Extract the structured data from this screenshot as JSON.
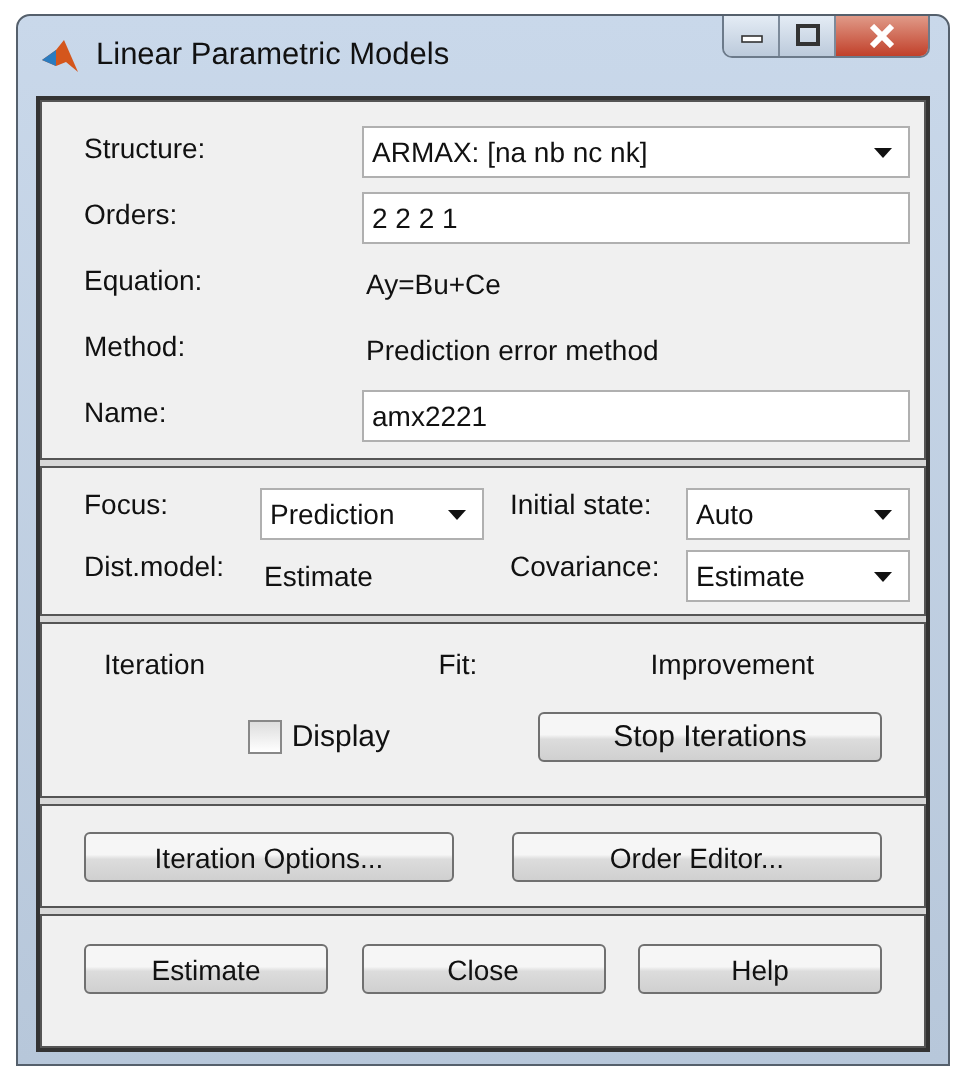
{
  "window": {
    "title": "Linear Parametric Models"
  },
  "model": [
    {
      "kind": "dropdown",
      "label": "Structure:",
      "value": "ARMAX: [na nb nc nk]"
    },
    {
      "kind": "input",
      "label": "Orders:",
      "value": "2 2 2 1"
    },
    {
      "kind": "text",
      "label": "Equation:",
      "value": "Ay=Bu+Ce"
    },
    {
      "kind": "text",
      "label": "Method:",
      "value": "Prediction error method"
    },
    {
      "kind": "input",
      "label": "Name:",
      "value": "amx2221"
    }
  ],
  "options": {
    "focus": {
      "label": "Focus:",
      "value": "Prediction"
    },
    "initial_state": {
      "label": "Initial state:",
      "value": "Auto"
    },
    "dist_model": {
      "label": "Dist.model:",
      "value": "Estimate"
    },
    "covariance": {
      "label": "Covariance:",
      "value": "Estimate"
    }
  },
  "iteration": {
    "headers": [
      "Iteration",
      "Fit:",
      "Improvement"
    ],
    "display": {
      "label": "Display",
      "checked": false
    },
    "stop_button": "Stop Iterations"
  },
  "tool_buttons": [
    "Iteration Options...",
    "Order Editor..."
  ],
  "buttons": [
    "Estimate",
    "Close",
    "Help"
  ]
}
